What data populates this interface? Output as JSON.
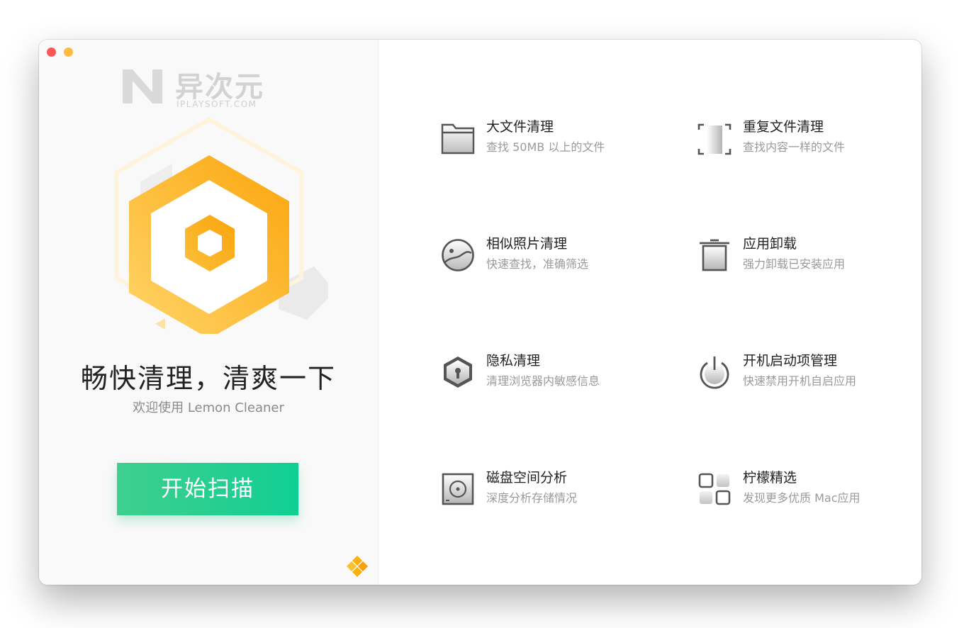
{
  "app": {
    "name": "Lemon Cleaner"
  },
  "watermark": {
    "text": "异次元",
    "sub": "IPLAYSOFT.COM"
  },
  "hero": {
    "headline": "畅快清理，清爽一下",
    "subline": "欢迎使用 Lemon Cleaner",
    "scan_button": "开始扫描"
  },
  "features": [
    {
      "title": "大文件清理",
      "desc": "查找 50MB 以上的文件",
      "icon": "folder-icon"
    },
    {
      "title": "重复文件清理",
      "desc": "查找内容一样的文件",
      "icon": "duplicate-files-icon"
    },
    {
      "title": "相似照片清理",
      "desc": "快速查找，准确筛选",
      "icon": "photo-icon"
    },
    {
      "title": "应用卸载",
      "desc": "强力卸载已安装应用",
      "icon": "trash-icon"
    },
    {
      "title": "隐私清理",
      "desc": "清理浏览器内敏感信息",
      "icon": "privacy-lock-icon"
    },
    {
      "title": "开机启动项管理",
      "desc": "快速禁用开机自启应用",
      "icon": "power-icon"
    },
    {
      "title": "磁盘空间分析",
      "desc": "深度分析存储情况",
      "icon": "disk-icon"
    },
    {
      "title": "柠檬精选",
      "desc": "发现更多优质 Mac应用",
      "icon": "apps-grid-icon"
    }
  ],
  "colors": {
    "accent_green": "#10cf92",
    "accent_orange": "#fba90b",
    "close": "#fc5753",
    "minimize": "#fdbc40"
  }
}
